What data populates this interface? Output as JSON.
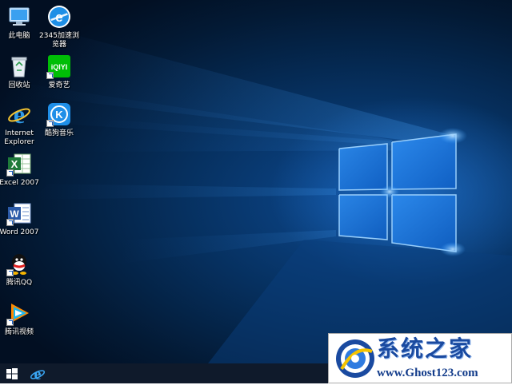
{
  "desktop_icons": [
    {
      "label": "此电脑",
      "label2": "",
      "icon": "this-pc-icon"
    },
    {
      "label": "2345加速浏",
      "label2": "览器",
      "icon": "2345-browser-icon"
    },
    {
      "label": "回收站",
      "label2": "",
      "icon": "recycle-bin-icon"
    },
    {
      "label": "爱奇艺",
      "label2": "",
      "icon": "iqiyi-icon",
      "logo_text": "iQIYI"
    },
    {
      "label": "Internet",
      "label2": "Explorer",
      "icon": "internet-explorer-icon"
    },
    {
      "label": "酷狗音乐",
      "label2": "",
      "icon": "kugou-music-icon",
      "logo_text": "K"
    },
    {
      "label": "Excel 2007",
      "label2": "",
      "icon": "excel-icon"
    },
    {
      "label": "Word 2007",
      "label2": "",
      "icon": "word-icon"
    },
    {
      "label": "腾讯QQ",
      "label2": "",
      "icon": "qq-icon"
    },
    {
      "label": "腾讯视频",
      "label2": "",
      "icon": "tencent-video-icon"
    }
  ],
  "taskbar": {
    "start_icon": "windows-start-icon",
    "pinned": [
      {
        "icon": "internet-explorer-icon"
      }
    ]
  },
  "watermark": {
    "title": "系统之家",
    "url": "www.Ghost123.com"
  },
  "colors": {
    "desktop_bg": "#06305f",
    "light_beam": "#3aa0ff",
    "taskbar": "#0f1a2b",
    "watermark_text": "#1a4aa0"
  }
}
